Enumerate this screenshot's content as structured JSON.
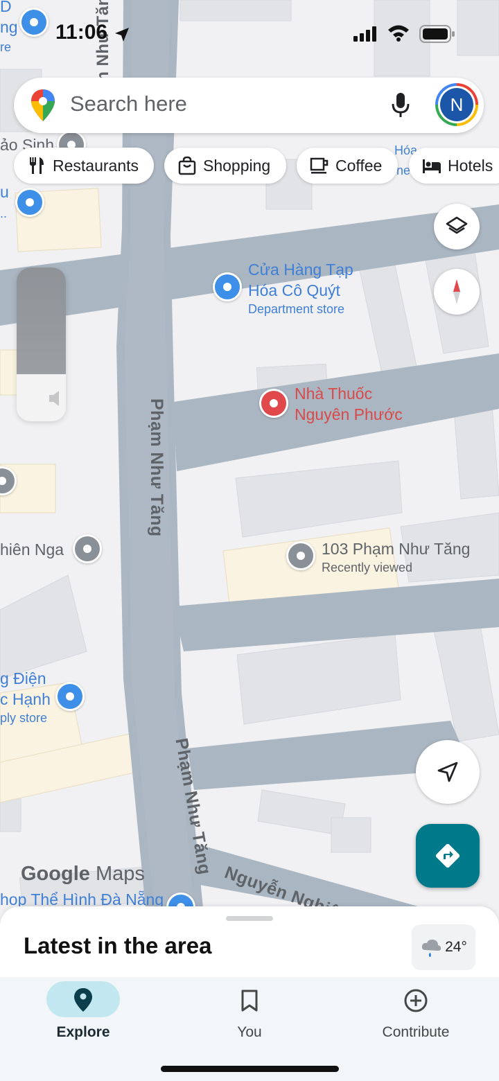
{
  "status_bar": {
    "time": "11:06"
  },
  "search": {
    "placeholder": "Search here",
    "avatar_letter": "N"
  },
  "chips": [
    {
      "label": "Restaurants",
      "icon": "fork-knife-icon"
    },
    {
      "label": "Shopping",
      "icon": "shopping-bag-icon"
    },
    {
      "label": "Coffee",
      "icon": "coffee-cup-icon"
    },
    {
      "label": "Hotels",
      "icon": "bed-icon"
    }
  ],
  "map": {
    "roads": {
      "pham_nhu_tang_top": "Phạm Như Tăng",
      "pham_nhu_tang_mid": "Phạm Như Tăng",
      "pham_nhu_tang_bottom": "Phạm Như Tăng",
      "nguyen_nghiem": "Nguyễn Nghiê"
    },
    "pois": {
      "cuahang_line1": "Cửa Hàng Tạp",
      "cuahang_line2": "Hóa Cô Quýt",
      "cuahang_category": "Department store",
      "nhathuoc_line1": "Nhà Thuốc",
      "nhathuoc_line2": "Nguyên Phước",
      "address_title": "103 Phạm Như Tăng",
      "address_sub": "Recently viewed",
      "thien_nga": "hiên Nga",
      "dien_line1": "g Điện",
      "dien_line2": "c Hạnh",
      "dien_category": "ply store",
      "gym": "hop Thể Hình Đà Nẵng",
      "top_left_1": "D",
      "top_left_2": "ng",
      "top_left_3": "re",
      "bao_sinh": "ảo Sinh",
      "left_u": "u",
      "left_dots": "..",
      "top_right_1": "Hóa",
      "top_right_2": "ne"
    },
    "attribution": {
      "google": "Google",
      "maps": "Maps"
    }
  },
  "sheet": {
    "title": "Latest in the area",
    "temperature": "24°"
  },
  "bottom_nav": [
    {
      "label": "Explore",
      "icon": "explore-pin-icon",
      "active": true
    },
    {
      "label": "You",
      "icon": "bookmark-icon",
      "active": false
    },
    {
      "label": "Contribute",
      "icon": "plus-circle-icon",
      "active": false
    }
  ],
  "colors": {
    "road": "#aab6c2",
    "block": "#e3e4e8",
    "sand_block": "#faf3e1",
    "poi_blue": "#3d8fe8",
    "poi_red": "#e1484b",
    "directions": "#00798a",
    "explore_active": "#c2e7f0"
  }
}
